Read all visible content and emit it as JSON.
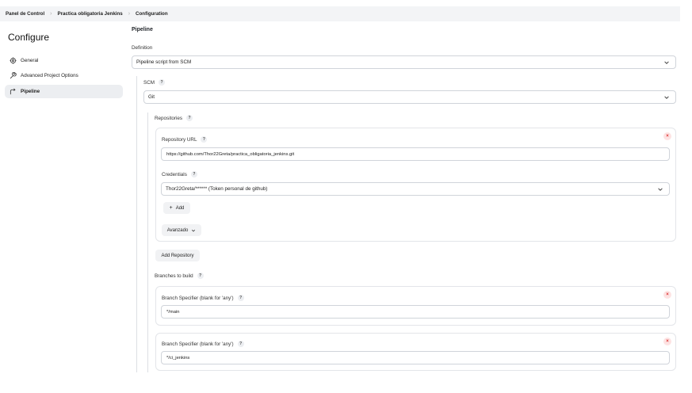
{
  "breadcrumb": [
    "Panel de Control",
    "Practica obligatoria Jenkins",
    "Configuration"
  ],
  "sidebar": {
    "title": "Configure",
    "items": [
      {
        "label": "General",
        "icon": "gear-icon"
      },
      {
        "label": "Advanced Project Options",
        "icon": "wrench-icon"
      },
      {
        "label": "Pipeline",
        "icon": "pipeline-icon"
      }
    ]
  },
  "pipeline": {
    "title": "Pipeline",
    "definition_label": "Definition",
    "definition_value": "Pipeline script from SCM",
    "scm_label": "SCM",
    "scm_value": "Git",
    "repositories_label": "Repositories",
    "repository_url_label": "Repository URL",
    "repository_url_value": "https://github.com/Thor22Greta/practica_obligatoria_jenkins.git",
    "credentials_label": "Credentials",
    "credentials_value": "Thor22Greta/****** (Token personal de github)",
    "add_label": "Add",
    "advanced_label": "Avanzado",
    "add_repository_label": "Add Repository",
    "branches_label": "Branches to build",
    "branches": [
      {
        "label": "Branch Specifier (blank for 'any')",
        "value": "*/main"
      },
      {
        "label": "Branch Specifier (blank for 'any')",
        "value": "*/ci_jenkins"
      }
    ],
    "help_glyph": "?",
    "close_glyph": "×",
    "plus_glyph": "+",
    "chevron_glyph": "⌄"
  }
}
